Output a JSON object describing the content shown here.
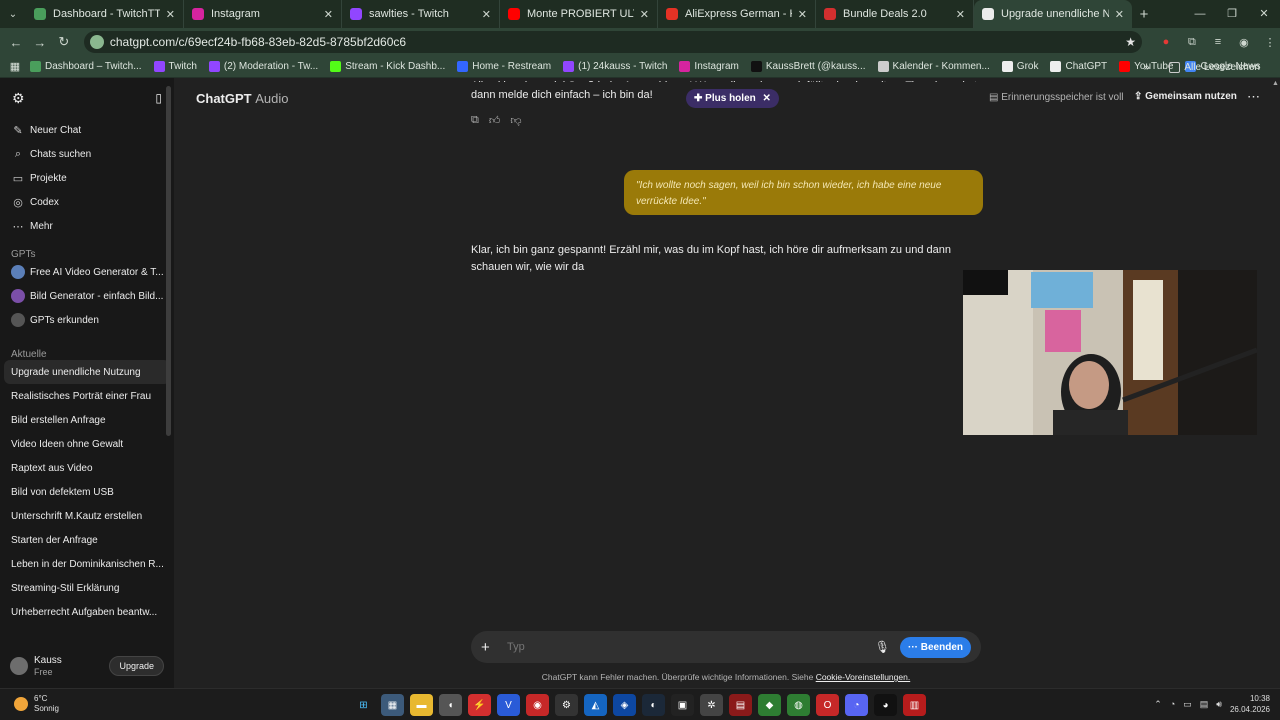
{
  "browser": {
    "tabs": [
      {
        "label": "Dashboard - TwitchTTS",
        "color": "#4a9e5c"
      },
      {
        "label": "Instagram",
        "color": "#d6249f"
      },
      {
        "label": "sawlties - Twitch",
        "color": "#9146ff"
      },
      {
        "label": "Monte PROBIERT ULTRA Tot Sa",
        "color": "#ff0000"
      },
      {
        "label": "AliExpress German - Kaufen Sie",
        "color": "#e43225"
      },
      {
        "label": "Bundle Deals 2.0",
        "color": "#d32f2f"
      },
      {
        "label": "Upgrade unendliche Nutzu",
        "color": "#ececec",
        "active": true
      }
    ],
    "url": "chatgpt.com/c/69ecf24b-fb68-83eb-82d5-8785bf2d60c6",
    "bookmarks": [
      {
        "label": "Dashboard – Twitch...",
        "color": "#4a9e5c"
      },
      {
        "label": "Twitch",
        "color": "#9146ff"
      },
      {
        "label": "(2) Moderation - Tw...",
        "color": "#9146ff"
      },
      {
        "label": "Stream - Kick Dashb...",
        "color": "#53fc18"
      },
      {
        "label": "Home - Restream",
        "color": "#3366ff"
      },
      {
        "label": "(1) 24kauss - Twitch",
        "color": "#9146ff"
      },
      {
        "label": "Instagram",
        "color": "#d6249f"
      },
      {
        "label": "KaussBrett (@kauss...",
        "color": "#111111"
      },
      {
        "label": "Kalender - Kommen...",
        "color": "#cccccc"
      },
      {
        "label": "Grok",
        "color": "#eeeeee"
      },
      {
        "label": "ChatGPT",
        "color": "#eeeeee"
      },
      {
        "label": "YouTube",
        "color": "#ff0000"
      },
      {
        "label": "Google News",
        "color": "#4285f4"
      }
    ],
    "all_bookmarks": "Alle Lesezeichen"
  },
  "sidebar": {
    "nav": [
      {
        "icon": "✎",
        "label": "Neuer Chat"
      },
      {
        "icon": "⌕",
        "label": "Chats suchen"
      },
      {
        "icon": "▭",
        "label": "Projekte"
      },
      {
        "icon": "◎",
        "label": "Codex"
      },
      {
        "icon": "⋯",
        "label": "Mehr"
      }
    ],
    "gpts_heading": "GPTs",
    "gpts": [
      {
        "label": "Free AI Video Generator & T...",
        "color": "#5b7fb8"
      },
      {
        "label": "Bild Generator - einfach Bild...",
        "color": "#7b4fa8"
      },
      {
        "label": "GPTs erkunden",
        "color": "#555555"
      }
    ],
    "recent_heading": "Aktuelle",
    "recent": [
      "Upgrade unendliche Nutzung",
      "Realistisches Porträt einer Frau",
      "Bild erstellen Anfrage",
      "Video Ideen ohne Gewalt",
      "Raptext aus Video",
      "Bild von defektem USB",
      "Unterschrift M.Kautz erstellen",
      "Starten der Anfrage",
      "Leben in der Dominikanischen R...",
      "Streaming-Stil Erklärung",
      "Urheberrecht Aufgaben beantw..."
    ],
    "user": {
      "name": "Kauss",
      "plan": "Free",
      "upgrade": "Upgrade"
    }
  },
  "header": {
    "brand": "ChatGPT",
    "mode": "Audio",
    "memory": "Erinnerungsspeicher ist voll",
    "share": "Gemeinsam nutzen"
  },
  "chat": {
    "prev_line1": "Alles klar, dann viel Spaß beim Ausprobieren! Wenn dir noch was einfällt oder du weitere Tipps brauchst,",
    "prev_line2": "dann melde dich einfach – ich bin da!",
    "plus_pill": "Plus holen",
    "user_message": "\"Ich wollte noch sagen, weil ich bin schon wieder, ich habe eine neue verrückte Idee.\"",
    "assistant_reply": "Klar, ich bin ganz gespannt! Erzähl mir, was du im Kopf hast, ich höre dir aufmerksam zu und dann schauen wir, wie wir da"
  },
  "composer": {
    "placeholder": "Typ",
    "end_label": "Beenden"
  },
  "footer": {
    "disclaimer": "ChatGPT kann Fehler machen. Überprüfe wichtige Informationen. Siehe",
    "link": "Cookie-Voreinstellungen."
  },
  "taskbar": {
    "temp": "6°C",
    "weather": "Sonnig",
    "time": "10:38",
    "date": "26.04.2026"
  }
}
